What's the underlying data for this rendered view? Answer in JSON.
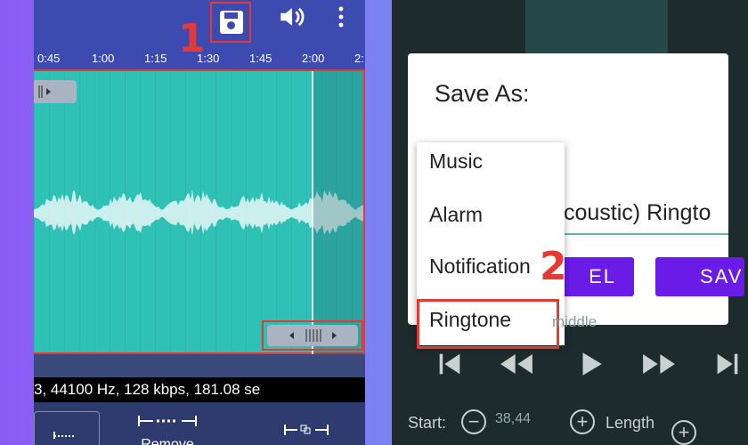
{
  "annotations": {
    "step1": "1",
    "step2": "2"
  },
  "left_screen": {
    "timeline_ticks": [
      "0:45",
      "1:00",
      "1:15",
      "1:30",
      "1:45",
      "2:00",
      "2:"
    ],
    "info_text": "3, 44100 Hz, 128 kbps, 181.08 se",
    "bottom_remove_label": "Remove",
    "icons": [
      "save-icon",
      "volume-icon",
      "more-vert-icon"
    ]
  },
  "right_screen": {
    "dialog_title": "Save As:",
    "name_field_value": "coustic) Ringto",
    "cancel_label": "EL",
    "save_label": "SAV",
    "menu_items": [
      "Music",
      "Alarm",
      "Notification",
      "Ringtone"
    ],
    "under_text": "middle",
    "start_label": "Start:",
    "start_value": "38,44",
    "length_label": "Length"
  },
  "colors": {
    "accent_red": "#e53935",
    "toolbar_blue": "#3d4bb0",
    "waveform_teal": "#2fc0b6",
    "dialog_button": "#6a1be8"
  }
}
